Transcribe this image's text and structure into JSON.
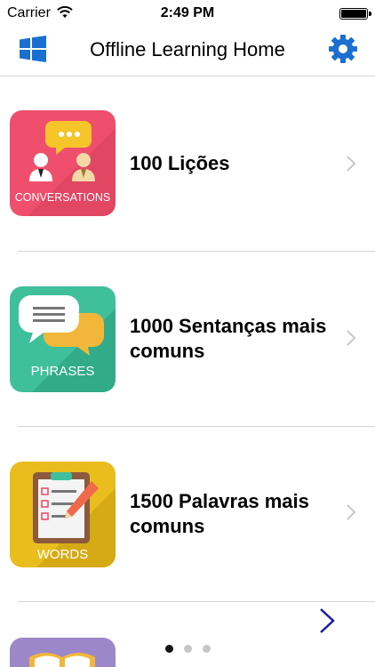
{
  "status_bar": {
    "carrier": "Carrier",
    "time": "2:49 PM"
  },
  "nav": {
    "title": "Offline Learning Home",
    "left_icon": "windows-icon",
    "right_icon": "gear-icon",
    "accent_color": "#1a6fd1"
  },
  "items": [
    {
      "label": "100 Lições",
      "thumb_text": "CONVERSATIONS",
      "thumb_color": "#ef4f6c"
    },
    {
      "label": "1000 Sentanças mais comuns",
      "thumb_text": "PHRASES",
      "thumb_color": "#3fbf9b"
    },
    {
      "label": "1500 Palavras mais comuns",
      "thumb_text": "WORDS",
      "thumb_color": "#e9bd1d"
    },
    {
      "label": "",
      "thumb_text": "",
      "thumb_color": "#9c88c9"
    }
  ],
  "pagination": {
    "pages": 3,
    "current": 1
  }
}
